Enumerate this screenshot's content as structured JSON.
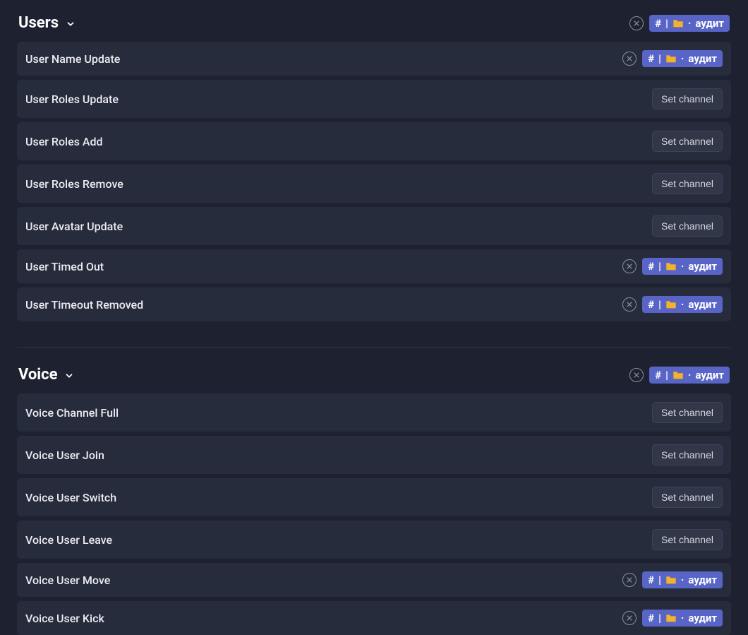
{
  "channel_badge": {
    "hash": "#",
    "bar": "|",
    "dot": "·",
    "name": "аудит"
  },
  "set_channel_label": "Set channel",
  "sections": {
    "users": {
      "title": "Users",
      "has_channel": true,
      "rows": [
        {
          "label": "User Name Update",
          "has_channel": true
        },
        {
          "label": "User Roles Update",
          "has_channel": false
        },
        {
          "label": "User Roles Add",
          "has_channel": false
        },
        {
          "label": "User Roles Remove",
          "has_channel": false
        },
        {
          "label": "User Avatar Update",
          "has_channel": false
        },
        {
          "label": "User Timed Out",
          "has_channel": true
        },
        {
          "label": "User Timeout Removed",
          "has_channel": true
        }
      ]
    },
    "voice": {
      "title": "Voice",
      "has_channel": true,
      "rows": [
        {
          "label": "Voice Channel Full",
          "has_channel": false
        },
        {
          "label": "Voice User Join",
          "has_channel": false
        },
        {
          "label": "Voice User Switch",
          "has_channel": false
        },
        {
          "label": "Voice User Leave",
          "has_channel": false
        },
        {
          "label": "Voice User Move",
          "has_channel": true
        },
        {
          "label": "Voice User Kick",
          "has_channel": true
        }
      ]
    }
  }
}
